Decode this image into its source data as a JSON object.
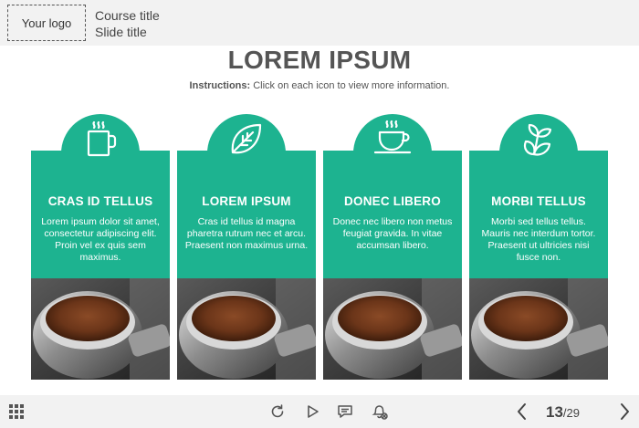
{
  "header": {
    "logo": "Your logo",
    "course_title": "Course title",
    "slide_title": "Slide title"
  },
  "slide": {
    "heading": "LOREM IPSUM",
    "instructions_label": "Instructions:",
    "instructions_text": " Click on each icon to view more information."
  },
  "cards": [
    {
      "title": "CRAS ID TELLUS",
      "text": "Lorem ipsum dolor sit amet, consectetur adipiscing elit. Proin vel ex quis sem maximus.",
      "icon": "coffee-mug-icon"
    },
    {
      "title": "LOREM IPSUM",
      "text": "Cras id tellus id magna pharetra rutrum nec et arcu. Praesent non maximus urna.",
      "icon": "leaf-icon"
    },
    {
      "title": "DONEC LIBERO",
      "text": "Donec nec libero non metus feugiat gravida. In vitae accumsan libero.",
      "icon": "coffee-cup-icon"
    },
    {
      "title": "MORBI TELLUS",
      "text": "Morbi sed tellus tellus. Mauris nec interdum tortor. Praesent ut ultricies nisi fusce non.",
      "icon": "tea-leaves-icon"
    }
  ],
  "footer": {
    "current_page": "13",
    "total_pages": "/29"
  },
  "colors": {
    "accent": "#1db390",
    "header_bg": "#f2f2f2"
  }
}
